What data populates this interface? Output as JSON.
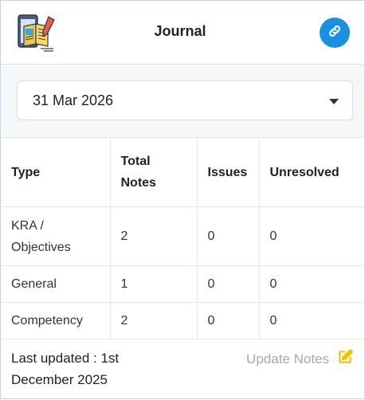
{
  "header": {
    "title": "Journal",
    "link_icon": "link-icon",
    "logo_icon": "journal-book-icon"
  },
  "date_selector": {
    "value": "31 Mar 2026",
    "icon": "caret-down-icon"
  },
  "table": {
    "columns": [
      "Type",
      "Total Notes",
      "Issues",
      "Unresolved"
    ],
    "rows": [
      {
        "type": "KRA / Objectives",
        "total": "2",
        "issues": "0",
        "unresolved": "0"
      },
      {
        "type": "General",
        "total": "1",
        "issues": "0",
        "unresolved": "0"
      },
      {
        "type": "Competency",
        "total": "2",
        "issues": "0",
        "unresolved": "0"
      }
    ]
  },
  "footer": {
    "last_updated": "Last updated : 1st December 2025",
    "update_label": "Update Notes",
    "update_icon": "edit-icon"
  },
  "colors": {
    "accent": "#1b8fe0",
    "edit_icon": "#f2c200",
    "muted_text": "#a8a8a8"
  }
}
